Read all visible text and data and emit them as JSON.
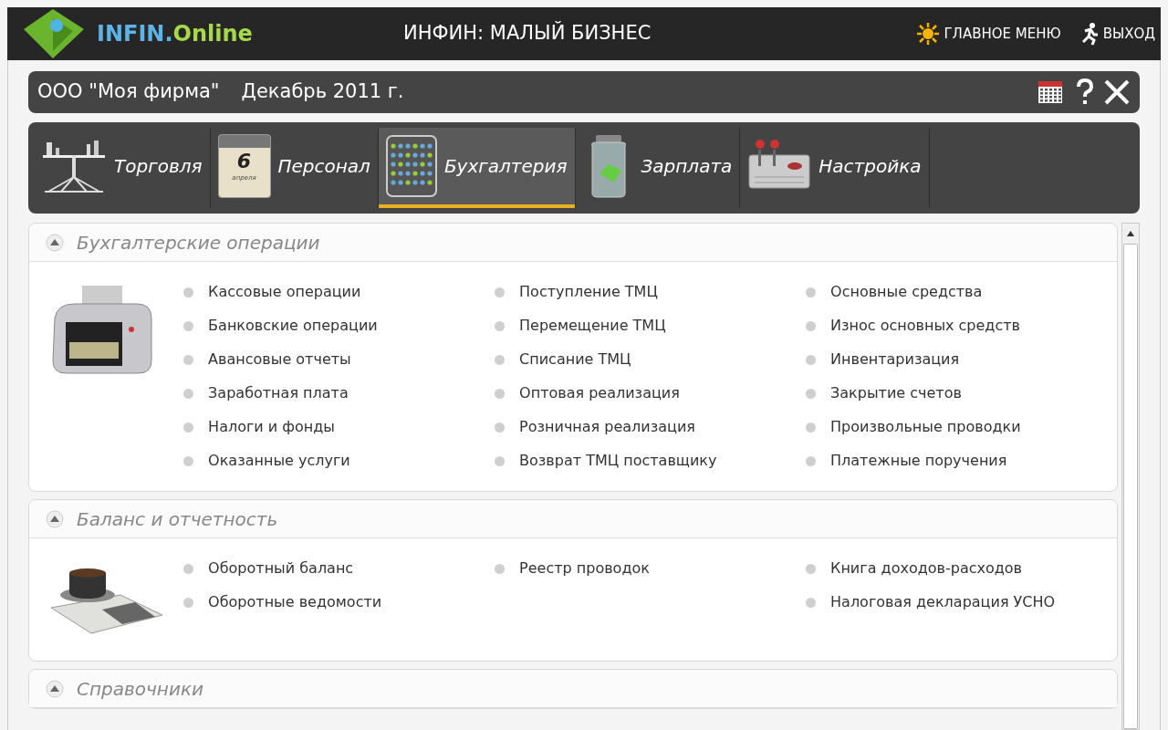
{
  "header": {
    "logo_text": "INFIN.",
    "logo_accent": "Online",
    "title": "ИНФИН: МАЛЫЙ БИЗНЕС",
    "links": [
      "ГЛАВНОЕ МЕНЮ",
      "ВЫХОД"
    ]
  },
  "context_bar": {
    "company": "ООО \"Моя фирма\"",
    "period": "Декабрь 2011 г."
  },
  "tabs": [
    {
      "label": "Торговля",
      "selected": false
    },
    {
      "label": "Персонал",
      "selected": false,
      "calendar_day": "6",
      "calendar_month": "апреля"
    },
    {
      "label": "Бухгалтерия",
      "selected": true
    },
    {
      "label": "Зарплата",
      "selected": false
    },
    {
      "label": "Настройка",
      "selected": false
    }
  ],
  "sections": [
    {
      "title": "Бухгалтерские операции",
      "expanded": true,
      "columns": [
        [
          "Кассовые операции",
          "Банковские операции",
          "Авансовые отчеты",
          "Заработная плата",
          "Налоги и фонды",
          "Оказанные услуги"
        ],
        [
          "Поступление ТМЦ",
          "Перемещение ТМЦ",
          "Списание ТМЦ",
          "Оптовая реализация",
          "Розничная реализация",
          "Возврат ТМЦ поставщику"
        ],
        [
          "Основные средства",
          "Износ основных средств",
          "Инвентаризация",
          "Закрытие счетов",
          "Произвольные проводки",
          "Платежные поручения"
        ]
      ]
    },
    {
      "title": "Баланс и отчетность",
      "expanded": true,
      "columns": [
        [
          "Оборотный баланс",
          "Оборотные ведомости"
        ],
        [
          "Реестр проводок"
        ],
        [
          "Книга доходов-расходов",
          "Налоговая декларация УСНО"
        ]
      ]
    },
    {
      "title": "Справочники",
      "expanded": true
    }
  ]
}
